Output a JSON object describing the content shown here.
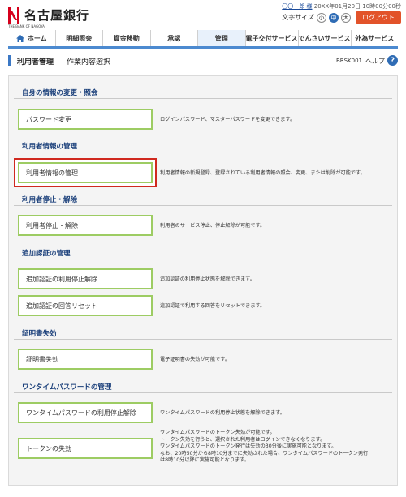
{
  "brand": {
    "name": "名古屋銀行",
    "sub": "THE BANK OF NAGOYA",
    "color": "#d6001c"
  },
  "user": {
    "name": "〇〇一郎 様",
    "last_login": "20XX年01月20日 10時00分00秒"
  },
  "font_size": {
    "label": "文字サイズ",
    "options": [
      "小",
      "中",
      "大"
    ],
    "selected": "中"
  },
  "logout_label": "ログアウト",
  "nav": {
    "items": [
      {
        "label": "ホーム",
        "icon": "home-icon"
      },
      {
        "label": "明細照会"
      },
      {
        "label": "資金移動"
      },
      {
        "label": "承認"
      },
      {
        "label": "管理",
        "active": true
      },
      {
        "label": "電子交付サービス"
      },
      {
        "label": "でんさいサービス"
      },
      {
        "label": "外為サービス"
      }
    ]
  },
  "title": {
    "main": "利用者管理",
    "sub": "作業内容選択",
    "code": "BRSK001",
    "help": "ヘルプ"
  },
  "sections": [
    {
      "title": "自身の情報の変更・照会",
      "items": [
        {
          "label": "パスワード変更",
          "desc": "ログインパスワード、マスターパスワードを変更できます。"
        }
      ]
    },
    {
      "title": "利用者情報の管理",
      "items": [
        {
          "label": "利用者情報の管理",
          "desc": "利用者情報の新規登録、登録されている利用者情報の照会、変更、または削除が可能です。",
          "selected": true
        }
      ]
    },
    {
      "title": "利用者停止・解除",
      "items": [
        {
          "label": "利用者停止・解除",
          "desc": "利用者のサービス停止、停止解除が可能です。"
        }
      ]
    },
    {
      "title": "追加認証の管理",
      "items": [
        {
          "label": "追加認証の利用停止解除",
          "desc": "追加認証の利用停止状態を解除できます。"
        },
        {
          "label": "追加認証の回答リセット",
          "desc": "追加認証で利用する回答をリセットできます。"
        }
      ]
    },
    {
      "title": "証明書失効",
      "items": [
        {
          "label": "証明書失効",
          "desc": "電子証明書の失効が可能です。"
        }
      ]
    },
    {
      "title": "ワンタイムパスワードの管理",
      "items": [
        {
          "label": "ワンタイムパスワードの利用停止解除",
          "desc": "ワンタイムパスワードの利用停止状態を解除できます。"
        },
        {
          "label": "トークンの失効",
          "desc_lines": [
            "ワンタイムパスワードのトークン失効が可能です。",
            "トークン失効を行うと、選択された利用者はログインできなくなります。",
            "ワンタイムパスワードのトークン発行は失効の30分後に実施可能となります。",
            "なお、20時50分から8時10分までに失効された場合、ワンタイムパスワードのトークン発行",
            "は8時10分以降に実施可能となります。"
          ]
        }
      ]
    }
  ]
}
